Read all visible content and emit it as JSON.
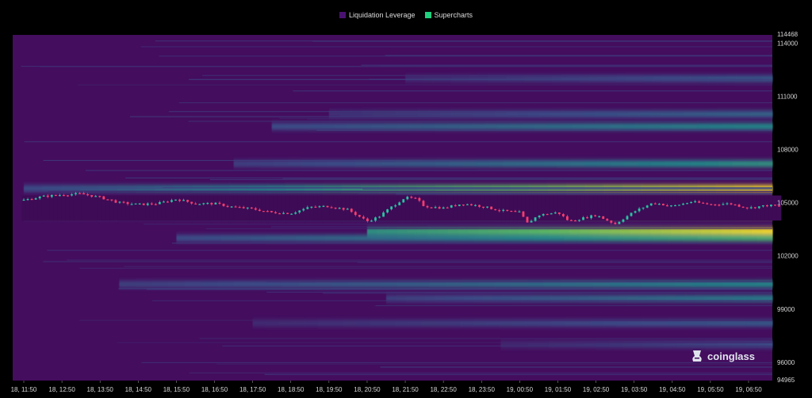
{
  "colors": {
    "liquidation_leverage": "#4a1270",
    "supercharts": "#1ed07e",
    "bull": "#26c6a0",
    "bear": "#ff3d6e"
  },
  "brand": {
    "text": "coinglass",
    "icon": "coinglass-logo-icon"
  },
  "chart_data": {
    "type": "heatmap",
    "legend": {
      "placement": "top-center",
      "items": [
        {
          "label": "Liquidation Leverage",
          "color": "#4a1270"
        },
        {
          "label": "Supercharts",
          "color": "#1ed07e"
        }
      ]
    },
    "y_axis": {
      "range": [
        94965,
        114468
      ],
      "ticks": [
        94965,
        96000,
        99000,
        102000,
        105000,
        108000,
        111000,
        114000,
        114468
      ]
    },
    "x_axis": {
      "ticks": [
        "18, 11:50",
        "18, 12:50",
        "18, 13:50",
        "18, 14:50",
        "18, 15:50",
        "18, 16:50",
        "18, 17:50",
        "18, 18:50",
        "18, 19:50",
        "18, 20:50",
        "18, 21:50",
        "18, 22:50",
        "18, 23:50",
        "19, 00:50",
        "19, 01:50",
        "19, 02:50",
        "19, 03:50",
        "19, 04:50",
        "19, 05:50",
        "19, 06:50"
      ]
    },
    "heat_bands": [
      {
        "price": 105800,
        "start": 0,
        "end": 19.8,
        "intensity_start": 0.25,
        "intensity_end": 1.0
      },
      {
        "price": 104300,
        "start": 0,
        "end": 19.8,
        "intensity_start": 0.2,
        "intensity_end": 0.8
      },
      {
        "price": 103400,
        "start": 9.0,
        "end": 19.8,
        "intensity_start": 0.55,
        "intensity_end": 1.0
      },
      {
        "price": 103000,
        "start": 4.0,
        "end": 19.8,
        "intensity_start": 0.25,
        "intensity_end": 0.65
      },
      {
        "price": 107200,
        "start": 5.5,
        "end": 19.8,
        "intensity_start": 0.2,
        "intensity_end": 0.55
      },
      {
        "price": 109300,
        "start": 6.5,
        "end": 19.8,
        "intensity_start": 0.25,
        "intensity_end": 0.5
      },
      {
        "price": 110000,
        "start": 8.0,
        "end": 19.8,
        "intensity_start": 0.15,
        "intensity_end": 0.35
      },
      {
        "price": 100400,
        "start": 2.5,
        "end": 19.8,
        "intensity_start": 0.2,
        "intensity_end": 0.5
      },
      {
        "price": 99600,
        "start": 9.5,
        "end": 19.8,
        "intensity_start": 0.2,
        "intensity_end": 0.45
      },
      {
        "price": 98200,
        "start": 6.0,
        "end": 19.8,
        "intensity_start": 0.12,
        "intensity_end": 0.3
      },
      {
        "price": 112000,
        "start": 10.0,
        "end": 19.8,
        "intensity_start": 0.12,
        "intensity_end": 0.3
      },
      {
        "price": 97000,
        "start": 12.5,
        "end": 19.8,
        "intensity_start": 0.1,
        "intensity_end": 0.25
      }
    ],
    "price_series": [
      {
        "t": 0.0,
        "price": 105150
      },
      {
        "t": 0.5,
        "price": 105350
      },
      {
        "t": 1.0,
        "price": 105450
      },
      {
        "t": 1.5,
        "price": 105500
      },
      {
        "t": 2.0,
        "price": 105300
      },
      {
        "t": 2.5,
        "price": 105000
      },
      {
        "t": 3.0,
        "price": 104900
      },
      {
        "t": 3.5,
        "price": 104950
      },
      {
        "t": 4.0,
        "price": 105200
      },
      {
        "t": 4.5,
        "price": 104950
      },
      {
        "t": 5.0,
        "price": 104950
      },
      {
        "t": 5.5,
        "price": 104750
      },
      {
        "t": 6.0,
        "price": 104650
      },
      {
        "t": 6.5,
        "price": 104450
      },
      {
        "t": 7.0,
        "price": 104400
      },
      {
        "t": 7.5,
        "price": 104750
      },
      {
        "t": 8.0,
        "price": 104800
      },
      {
        "t": 8.5,
        "price": 104600
      },
      {
        "t": 9.0,
        "price": 103950
      },
      {
        "t": 9.3,
        "price": 104200
      },
      {
        "t": 9.6,
        "price": 104700
      },
      {
        "t": 10.0,
        "price": 105300
      },
      {
        "t": 10.3,
        "price": 105200
      },
      {
        "t": 10.5,
        "price": 104800
      },
      {
        "t": 11.0,
        "price": 104700
      },
      {
        "t": 11.5,
        "price": 104950
      },
      {
        "t": 12.0,
        "price": 104800
      },
      {
        "t": 12.5,
        "price": 104550
      },
      {
        "t": 13.0,
        "price": 104450
      },
      {
        "t": 13.2,
        "price": 103850
      },
      {
        "t": 13.5,
        "price": 104300
      },
      {
        "t": 14.0,
        "price": 104450
      },
      {
        "t": 14.3,
        "price": 103950
      },
      {
        "t": 14.6,
        "price": 104100
      },
      {
        "t": 15.0,
        "price": 104300
      },
      {
        "t": 15.5,
        "price": 103800
      },
      {
        "t": 16.0,
        "price": 104500
      },
      {
        "t": 16.5,
        "price": 105000
      },
      {
        "t": 17.0,
        "price": 104800
      },
      {
        "t": 17.5,
        "price": 105050
      },
      {
        "t": 18.0,
        "price": 104900
      },
      {
        "t": 18.5,
        "price": 104950
      },
      {
        "t": 19.0,
        "price": 104700
      },
      {
        "t": 19.5,
        "price": 104850
      },
      {
        "t": 19.8,
        "price": 104800
      }
    ]
  }
}
